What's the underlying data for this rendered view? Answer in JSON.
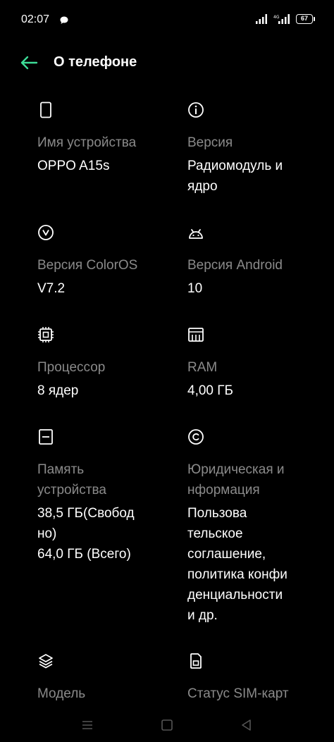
{
  "status_bar": {
    "time": "02:07",
    "battery": "67",
    "icons": [
      "chat-bubble-icon",
      "signal-icon",
      "data-4g-icon",
      "signal-icon"
    ]
  },
  "header": {
    "title": "О телефоне",
    "back_icon": "arrow-left-icon",
    "accent_color": "#3ddc97"
  },
  "items": [
    {
      "icon": "phone-icon",
      "label": "Имя устройства",
      "value": "OPPO A15s"
    },
    {
      "icon": "info-icon",
      "label": "Версия",
      "value": "Радиомодуль и\nядро"
    },
    {
      "icon": "coloros-v-icon",
      "label": "Версия ColorOS",
      "value": "V7.2"
    },
    {
      "icon": "android-icon",
      "label": "Версия Android",
      "value": "10"
    },
    {
      "icon": "processor-icon",
      "label": "Процессор",
      "value": "8 ядер"
    },
    {
      "icon": "ram-icon",
      "label": "RAM",
      "value": "4,00 ГБ"
    },
    {
      "icon": "storage-icon",
      "label": "Память\nустройства",
      "value": "38,5 ГБ(Свобод\nно)\n64,0 ГБ (Всего)"
    },
    {
      "icon": "copyright-icon",
      "label": "Юридическая и\nнформация",
      "value": "Пользова\nтельское\nсоглашение,\nполитика конфи\nденциальности\nи др."
    },
    {
      "icon": "layers-icon",
      "label": "Модель",
      "value": ""
    },
    {
      "icon": "sim-card-icon",
      "label": "Статус SIM-карт",
      "value": ""
    }
  ],
  "nav_bar": {
    "icons": [
      "menu-icon",
      "home-square-icon",
      "back-triangle-icon"
    ]
  }
}
